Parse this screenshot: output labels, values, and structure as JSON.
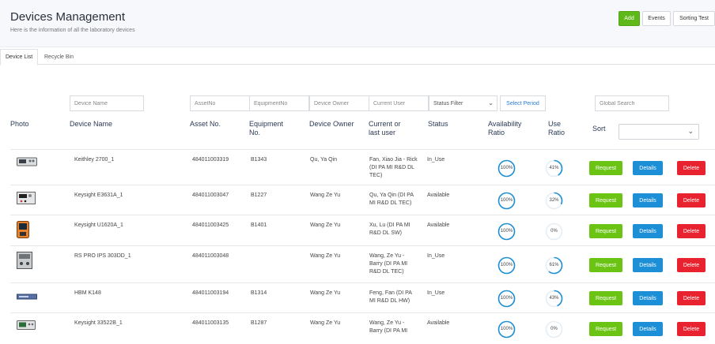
{
  "header": {
    "title": "Devices Management",
    "subtitle": "Here is the information of all the laboratory devices",
    "add_label": "Add",
    "events_label": "Events",
    "sorting_test_label": "Sorting Test"
  },
  "tabs": [
    {
      "label": "Device List",
      "active": true
    },
    {
      "label": "Recycle Bin",
      "active": false
    }
  ],
  "filters": {
    "device_name": "Device Name",
    "asset_no": "AssetNo",
    "equipment_no": "EquipmentNo",
    "device_owner": "Device Owner",
    "current_user": "Current User",
    "status_filter": "Status Filter",
    "select_period": "Select Period",
    "global_search": "Global Search"
  },
  "columns": {
    "photo": "Photo",
    "device_name": "Device Name",
    "asset_no": "Asset No.",
    "equipment_no_1": "Equipment",
    "equipment_no_2": "No.",
    "device_owner": "Device Owner",
    "current_user_1": "Current or",
    "current_user_2": "last user",
    "status": "Status",
    "availability_1": "Availability",
    "availability_2": "Ratio",
    "use_1": "Use",
    "use_2": "Ratio",
    "sort": "Sort"
  },
  "actions": {
    "request": "Request",
    "details": "Details",
    "delete": "Delete"
  },
  "colors": {
    "add": "#5fb81a",
    "request": "#6bc414",
    "details": "#1d8fd6",
    "delete": "#e8222f",
    "ring": "#1d8fd6"
  },
  "rows": [
    {
      "device_name": "Keithley 2700_1",
      "asset_no": "484011003319",
      "equipment_no": "B1343",
      "owner": "Qu, Ya Qin",
      "user": [
        "Fan, Xiao Jia - Rick",
        "(DI PA MI R&D DL",
        "TEC)"
      ],
      "status": "In_Use",
      "availability": "100%",
      "availability_value": 1.0,
      "use": "41%",
      "use_value": 0.41,
      "photo_icon": "bench-dmm-icon"
    },
    {
      "device_name": "Keysight E3631A_1",
      "asset_no": "484011003047",
      "equipment_no": "B1227",
      "owner": "Wang Ze Yu",
      "user": [
        "Qu, Ya Qin (DI PA",
        "MI R&D DL TEC)"
      ],
      "status": "Available",
      "availability": "100%",
      "availability_value": 1.0,
      "use": "32%",
      "use_value": 0.32,
      "photo_icon": "power-supply-icon"
    },
    {
      "device_name": "Keysight U1620A_1",
      "asset_no": "484011003425",
      "equipment_no": "B1401",
      "owner": "Wang Ze Yu",
      "user": [
        "Xu, Lu (DI PA MI",
        "R&D DL SW)"
      ],
      "status": "Available",
      "availability": "100%",
      "availability_value": 1.0,
      "use": "0%",
      "use_value": 0.0,
      "photo_icon": "handheld-scope-icon"
    },
    {
      "device_name": "RS PRO IPS 303DD_1",
      "asset_no": "484011003048",
      "equipment_no": "",
      "owner": "Wang Ze Yu",
      "user": [
        "Wang, Ze Yu -",
        "Barry (DI PA MI",
        "R&D DL TEC)"
      ],
      "status": "In_Use",
      "availability": "100%",
      "availability_value": 1.0,
      "use": "61%",
      "use_value": 0.61,
      "photo_icon": "dc-supply-icon"
    },
    {
      "device_name": "HBM K148",
      "asset_no": "484011003194",
      "equipment_no": "B1314",
      "owner": "Wang Ze Yu",
      "user": [
        "Feng, Fan (DI PA",
        "MI R&D DL HW)"
      ],
      "status": "In_Use",
      "availability": "100%",
      "availability_value": 1.0,
      "use": "43%",
      "use_value": 0.43,
      "photo_icon": "rack-unit-icon"
    },
    {
      "device_name": "Keysight 33522B_1",
      "asset_no": "484011003135",
      "equipment_no": "B1287",
      "owner": "Wang Ze Yu",
      "user": [
        "Wang, Ze Yu -",
        "Barry (DI PA MI"
      ],
      "status": "Available",
      "availability": "100%",
      "availability_value": 1.0,
      "use": "0%",
      "use_value": 0.0,
      "photo_icon": "waveform-generator-icon"
    }
  ]
}
